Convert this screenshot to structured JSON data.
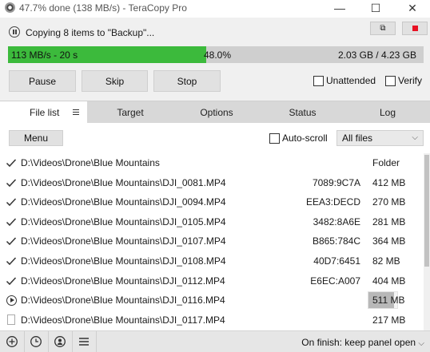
{
  "window": {
    "title": "47.7% done (138 MB/s) - TeraCopy Pro",
    "minimize_glyph": "—",
    "maximize_glyph": "☐",
    "close_glyph": "✕"
  },
  "panel": {
    "status_text": "Copying 8 items to \"Backup\"...",
    "progress": {
      "fraction": 0.477,
      "left_text": "113 MB/s - 20 s",
      "percent_text": "48.0%",
      "right_text": "2.03 GB / 4.23 GB"
    },
    "buttons": {
      "pause": "Pause",
      "skip": "Skip",
      "stop": "Stop"
    },
    "checks": {
      "unattended": "Unattended",
      "verify": "Verify"
    },
    "restore_glyph": "⧉"
  },
  "tabs": [
    {
      "label": "File list",
      "active": true
    },
    {
      "label": "Target",
      "active": false
    },
    {
      "label": "Options",
      "active": false
    },
    {
      "label": "Status",
      "active": false
    },
    {
      "label": "Log",
      "active": false
    }
  ],
  "toolbar": {
    "menu_label": "Menu",
    "autoscroll_label": "Auto-scroll",
    "filter_value": "All files"
  },
  "files": [
    {
      "state": "done",
      "path": "D:\\Videos\\Drone\\Blue Mountains",
      "hash": "",
      "size": "Folder"
    },
    {
      "state": "done",
      "path": "D:\\Videos\\Drone\\Blue Mountains\\DJI_0081.MP4",
      "hash": "7089:9C7A",
      "size": "412 MB"
    },
    {
      "state": "done",
      "path": "D:\\Videos\\Drone\\Blue Mountains\\DJI_0094.MP4",
      "hash": "EEA3:DECD",
      "size": "270 MB"
    },
    {
      "state": "done",
      "path": "D:\\Videos\\Drone\\Blue Mountains\\DJI_0105.MP4",
      "hash": "3482:8A6E",
      "size": "281 MB"
    },
    {
      "state": "done",
      "path": "D:\\Videos\\Drone\\Blue Mountains\\DJI_0107.MP4",
      "hash": "B865:784C",
      "size": "364 MB"
    },
    {
      "state": "done",
      "path": "D:\\Videos\\Drone\\Blue Mountains\\DJI_0108.MP4",
      "hash": "40D7:6451",
      "size": "82 MB"
    },
    {
      "state": "done",
      "path": "D:\\Videos\\Drone\\Blue Mountains\\DJI_0112.MP4",
      "hash": "E6EC:A007",
      "size": "404 MB"
    },
    {
      "state": "copying",
      "path": "D:\\Videos\\Drone\\Blue Mountains\\DJI_0116.MP4",
      "hash": "",
      "size": "511 MB",
      "progress": 0.9
    },
    {
      "state": "pending",
      "path": "D:\\Videos\\Drone\\Blue Mountains\\DJI_0117.MP4",
      "hash": "",
      "size": "217 MB"
    }
  ],
  "footer": {
    "icons": [
      "add-icon",
      "history-icon",
      "user-icon",
      "hamburger-icon"
    ],
    "on_finish": "On finish: keep panel open"
  },
  "colors": {
    "progress_fill": "#3cba3c",
    "stop_red": "#e81123",
    "panel_bg": "#f0f0f0",
    "tab_bg": "#d8d8d8"
  }
}
